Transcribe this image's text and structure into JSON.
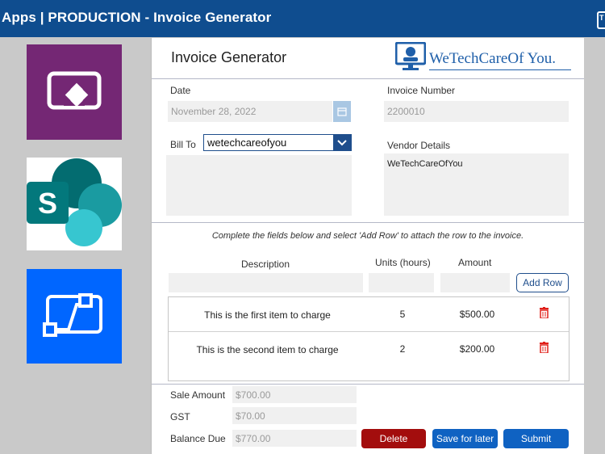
{
  "app": {
    "title": "Apps  |  PRODUCTION - Invoice Generator",
    "corner_letter": "T"
  },
  "sidebar": {
    "tiles": [
      "power-apps-tile",
      "sharepoint-tile",
      "power-automate-tile"
    ],
    "sharepoint_letter": "S"
  },
  "header": {
    "title": "Invoice Generator",
    "logo_text": "WeTechCareOf You."
  },
  "form": {
    "date_label": "Date",
    "date_value": "November 28, 2022",
    "invoice_number_label": "Invoice Number",
    "invoice_number_value": "2200010",
    "bill_to_label": "Bill To",
    "bill_to_value": "wetechcareofyou",
    "bill_to_details": "",
    "vendor_details_label": "Vendor Details",
    "vendor_details_value": "WeTechCareOfYou"
  },
  "instructions": "Complete the fields below and select 'Add Row' to attach the row to the invoice.",
  "line_entry": {
    "description_header": "Description",
    "units_header": "Units (hours)",
    "amount_header": "Amount",
    "description_value": "",
    "units_value": "",
    "amount_value": "",
    "add_row_label": "Add Row"
  },
  "items": [
    {
      "description": "This is the first item to charge",
      "units": "5",
      "amount": "$500.00"
    },
    {
      "description": "This is the second item to charge",
      "units": "2",
      "amount": "$200.00"
    }
  ],
  "totals": {
    "sale_amount_label": "Sale Amount",
    "sale_amount_value": "$700.00",
    "gst_label": "GST",
    "gst_value": "$70.00",
    "balance_due_label": "Balance Due",
    "balance_due_value": "$770.00"
  },
  "actions": {
    "delete_label": "Delete",
    "save_label": "Save for later",
    "submit_label": "Submit"
  },
  "colors": {
    "topbar": "#0f4d8f",
    "power_apps": "#742774",
    "power_automate": "#0066ff",
    "delete": "#a30d0d",
    "primary": "#0f62c2",
    "trash": "#e0201a"
  }
}
